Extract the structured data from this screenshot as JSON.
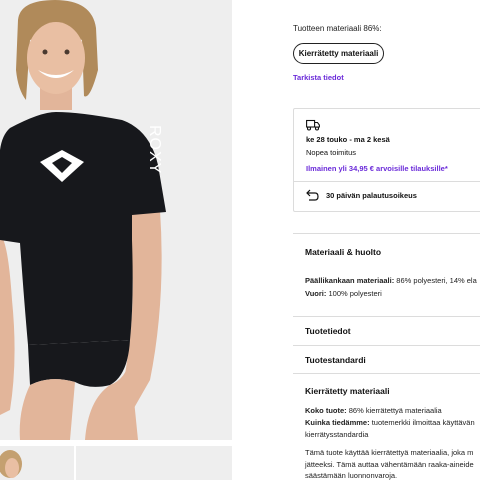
{
  "product": {
    "material_line": "Tuotteen materiaali 86%:",
    "material_pill": "Kierrätetty materiaali",
    "check_link": "Tarkista tiedot"
  },
  "delivery": {
    "icon": "truck-icon",
    "date": "ke 28 touko - ma 2 kesä",
    "speed": "Nopea toimitus",
    "free_shipping": "Ilmainen yli 34,95 € arvoisille tilauksille*",
    "return_icon": "return-arrow-icon",
    "returns": "30 päivän palautusoikeus"
  },
  "sections": {
    "material_care": {
      "title": "Materiaali & huolto",
      "fabric_label": "Päällikankaan materiaali:",
      "fabric_value": " 86% polyesteri, 14% ela",
      "lining_label": "Vuori:",
      "lining_value": " 100% polyesteri"
    },
    "product_info": {
      "title": "Tuotetiedot"
    },
    "product_standard": {
      "title": "Tuotestandardi"
    },
    "recycled": {
      "title": "Kierrätetty materiaali",
      "whole_label": "Koko tuote:",
      "whole_value": " 86% kierrätettyä materiaalia",
      "how_label": "Kuinka tiedämme:",
      "how_value": " tuotemerkki ilmoittaa käyttävän",
      "how_value_2": "kierrätysstandardia",
      "desc_1": "Tämä tuote käyttää kierrätettyä materiaalia, joka m",
      "desc_2": "jätteeksi. Tämä auttaa vähentämään raaka-aineide",
      "desc_3": "säästämään luonnonvaroja."
    }
  },
  "colors": {
    "accent": "#6b2bd9",
    "shirt": "#17181c",
    "background": "#eeeeee"
  }
}
